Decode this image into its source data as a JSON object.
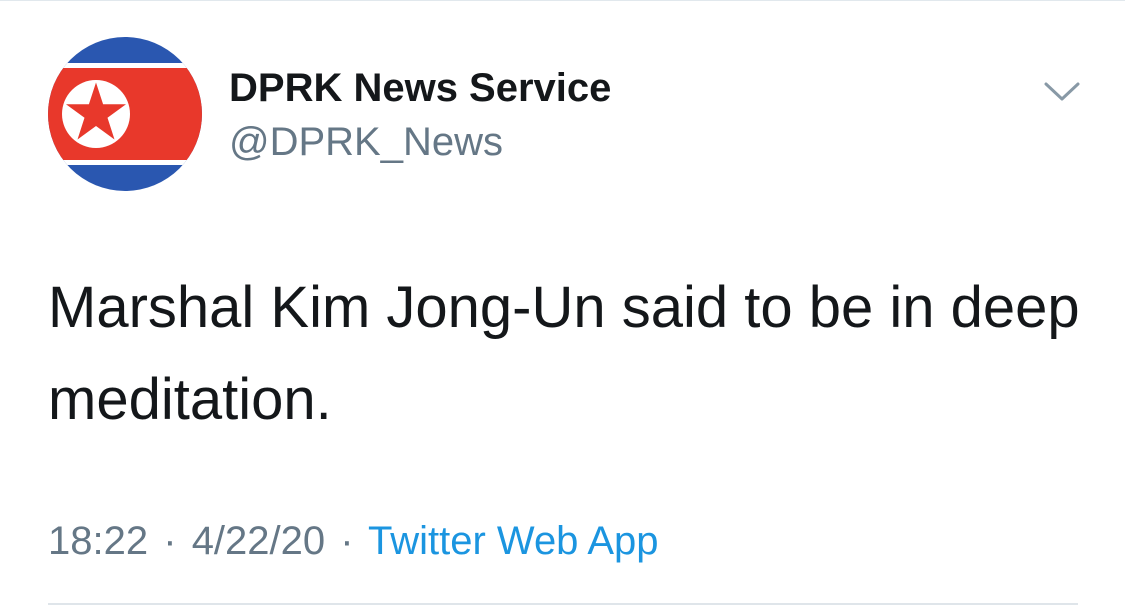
{
  "user": {
    "display_name": "DPRK News Service",
    "handle": "@DPRK_News",
    "avatar_icon": "north-korea-flag-icon"
  },
  "tweet": {
    "text": "Marshal Kim Jong-Un said to be in deep meditation."
  },
  "meta": {
    "time": "18:22",
    "separator": "·",
    "date": "4/22/20",
    "source": "Twitter Web App"
  },
  "icons": {
    "menu": "chevron-down-icon"
  },
  "colors": {
    "text_primary": "#14171a",
    "text_secondary": "#657786",
    "link": "#1b95e0",
    "flag_blue": "#2a57b0",
    "flag_red": "#e8382b",
    "flag_white": "#ffffff",
    "caret": "#8899a6"
  }
}
